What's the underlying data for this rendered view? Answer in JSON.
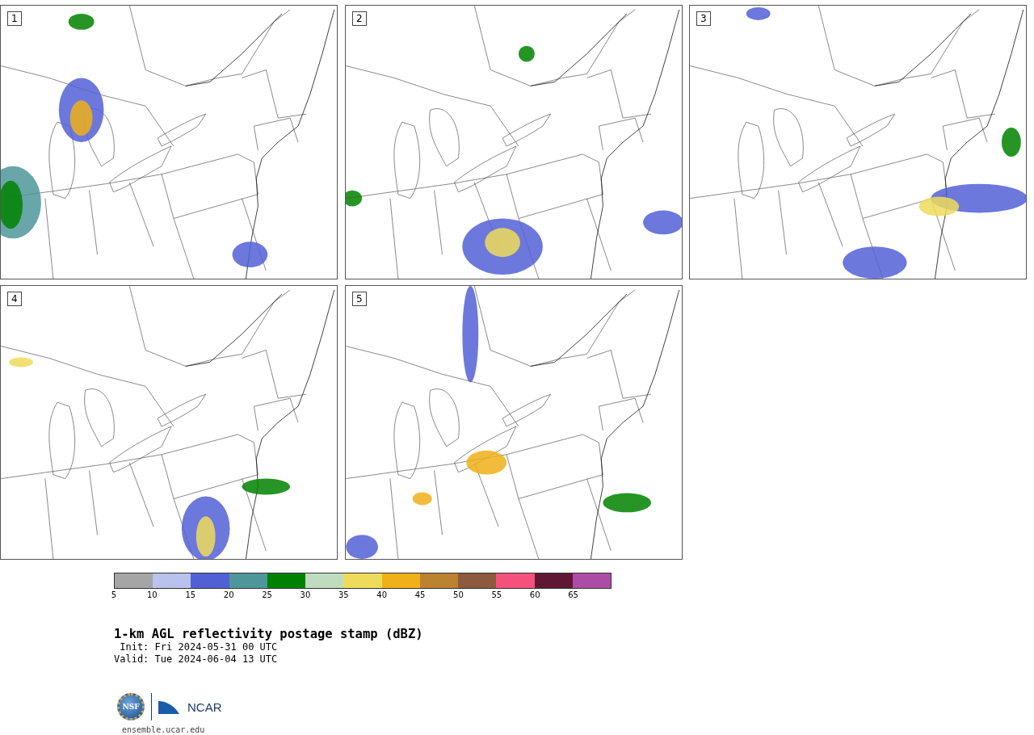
{
  "panels": [
    {
      "label": "1"
    },
    {
      "label": "2"
    },
    {
      "label": "3"
    },
    {
      "label": "4"
    },
    {
      "label": "5"
    }
  ],
  "colorbar": {
    "bins": [
      {
        "color": "#a5a5a5"
      },
      {
        "color": "#b8c2ec"
      },
      {
        "color": "#5260d6"
      },
      {
        "color": "#4f969b"
      },
      {
        "color": "#008200"
      },
      {
        "color": "#bfdcbf"
      },
      {
        "color": "#efdb5b"
      },
      {
        "color": "#efb019"
      },
      {
        "color": "#bb822f"
      },
      {
        "color": "#8b5a3f"
      },
      {
        "color": "#f4517c"
      },
      {
        "color": "#601733"
      },
      {
        "color": "#ad4ca6"
      }
    ],
    "ticks": [
      "5",
      "10",
      "15",
      "20",
      "25",
      "30",
      "35",
      "40",
      "45",
      "50",
      "55",
      "60",
      "65"
    ]
  },
  "title": "1-km AGL reflectivity postage stamp (dBZ)",
  "init": " Init: Fri 2024-05-31 00 UTC",
  "valid": "Valid: Tue 2024-06-04 13 UTC",
  "footer": {
    "logo_seal": "NSF",
    "logo_name": "NCAR",
    "url": "ensemble.ucar.edu"
  }
}
